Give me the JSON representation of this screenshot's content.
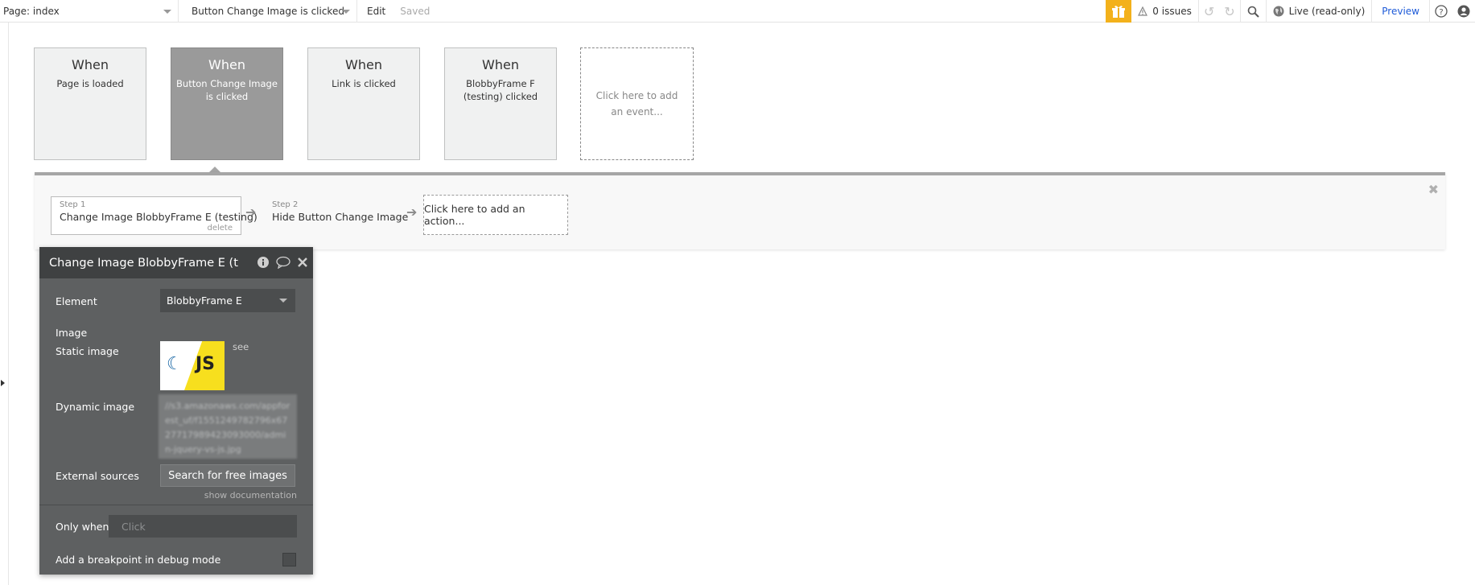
{
  "topbar": {
    "page_select": "Page: index",
    "event_select": "Button Change Image is clicked",
    "edit": "Edit",
    "saved": "Saved",
    "issues": "0 issues",
    "live": "Live (read-only)",
    "preview": "Preview",
    "accent_color": "#f3b11b"
  },
  "events": [
    {
      "when": "When",
      "desc": "Page is loaded"
    },
    {
      "when": "When",
      "desc": "Button Change Image is clicked"
    },
    {
      "when": "When",
      "desc": "Link is clicked"
    },
    {
      "when": "When",
      "desc": "BlobbyFrame F (testing) clicked"
    }
  ],
  "add_event": "Click here to add an event...",
  "steps": [
    {
      "num": "Step 1",
      "title": "Change Image BlobbyFrame E (testing)",
      "delete": "delete"
    },
    {
      "num": "Step 2",
      "title": "Hide Button Change Image"
    }
  ],
  "add_action": "Click here to add an action...",
  "panel": {
    "title": "Change Image BlobbyFrame E (t",
    "element_label": "Element",
    "element_value": "BlobbyFrame E",
    "image_label": "Image",
    "static_label": "Static image",
    "see": "see",
    "dynamic_label": "Dynamic image",
    "dynamic_value": "//s3.amazonaws.com/appforest_uf/f1551249782796x6727717989423093000/admin-jquery-vs-js.jpg",
    "external_label": "External sources",
    "search_button": "Search for free images",
    "show_doc": "show documentation",
    "only_when_label": "Only when",
    "only_when_placeholder": "Click",
    "breakpoint_label": "Add a breakpoint in debug mode",
    "thumb_text": "JS"
  }
}
